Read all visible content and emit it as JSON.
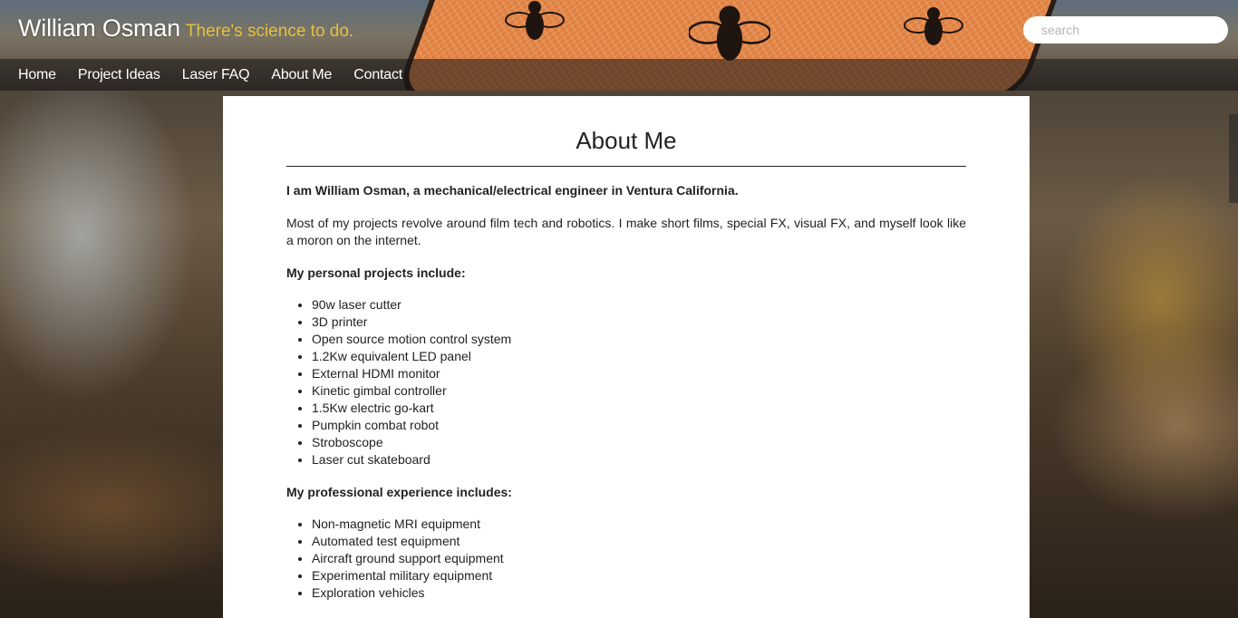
{
  "site": {
    "name": "William Osman",
    "tagline": "There's science to do."
  },
  "search": {
    "placeholder": "search",
    "value": ""
  },
  "nav": {
    "items": [
      "Home",
      "Project Ideas",
      "Laser FAQ",
      "About Me",
      "Contact"
    ]
  },
  "page": {
    "title": "About Me",
    "intro": "I am William Osman, a mechanical/electrical engineer in Ventura California.",
    "description": "Most of my projects revolve around film tech and robotics. I make short films, special FX, visual FX, and myself look like a moron on the internet.",
    "personal_heading": "My personal projects include:",
    "personal_projects": [
      "90w laser cutter",
      "3D printer",
      "Open source motion control system",
      "1.2Kw equivalent LED panel",
      "External HDMI monitor",
      "Kinetic gimbal controller",
      "1.5Kw electric go-kart",
      "Pumpkin combat robot",
      "Stroboscope",
      "Laser cut skateboard"
    ],
    "professional_heading": "My professional experience includes:",
    "professional_experience": [
      "Non-magnetic MRI equipment",
      "Automated test equipment",
      "Aircraft ground support equipment",
      "Experimental military equipment",
      "Exploration vehicles"
    ]
  },
  "colors": {
    "tagline": "#e6c13a",
    "header_sign": "#e0803f",
    "panel": "#ffffff"
  },
  "icons": [
    "bee-icon"
  ]
}
